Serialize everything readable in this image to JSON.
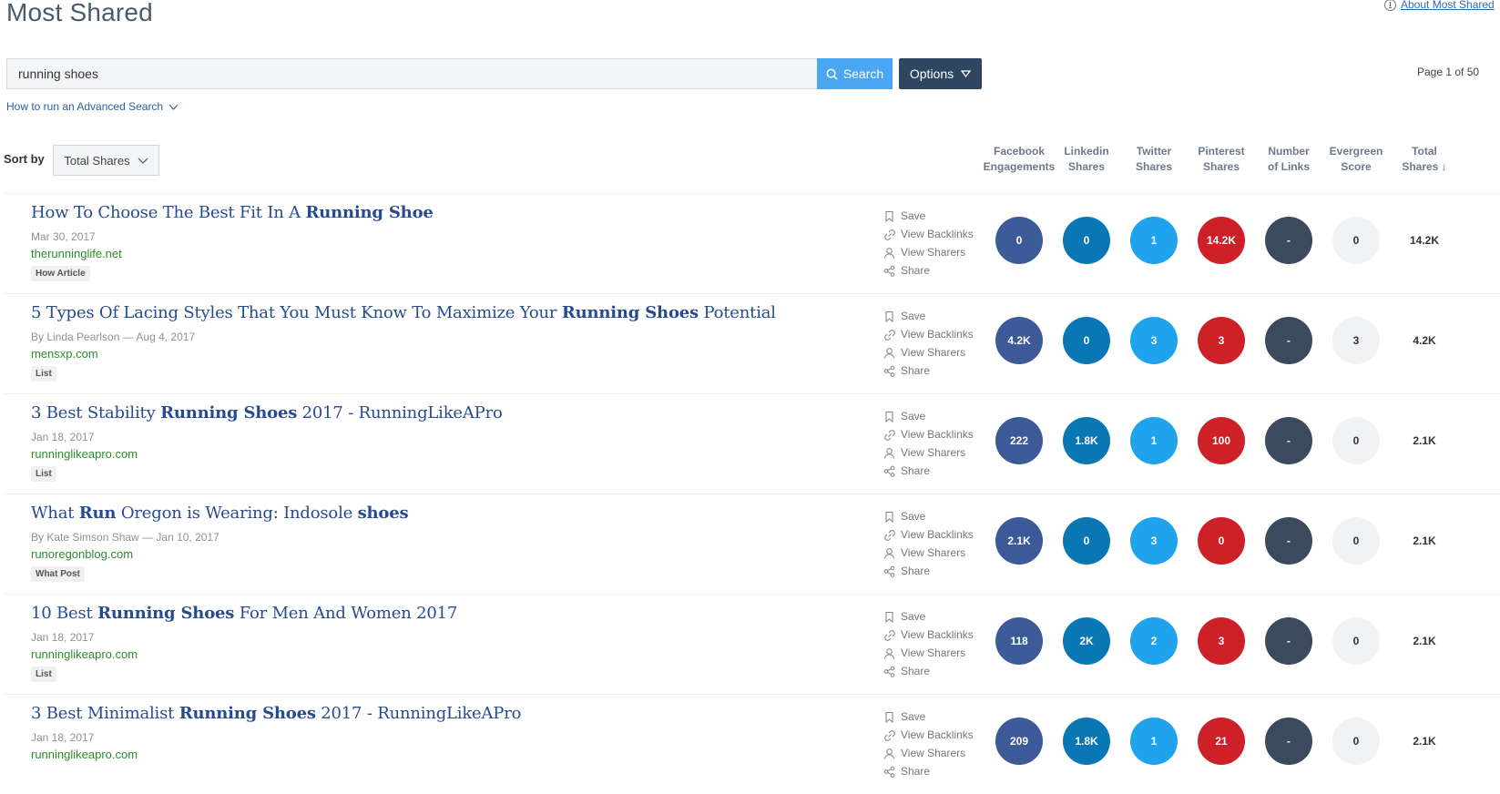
{
  "header": {
    "title": "Most Shared",
    "about_link": "About Most Shared"
  },
  "search": {
    "query": "running shoes",
    "placeholder": "",
    "search_label": "Search",
    "options_label": "Options",
    "page_indicator": "Page 1 of 50",
    "advanced_link": "How to run an Advanced Search"
  },
  "sort": {
    "label": "Sort by",
    "selected": "Total Shares"
  },
  "columns": [
    {
      "line1": "Facebook",
      "line2": "Engagements"
    },
    {
      "line1": "Linkedin",
      "line2": "Shares"
    },
    {
      "line1": "Twitter",
      "line2": "Shares"
    },
    {
      "line1": "Pinterest",
      "line2": "Shares"
    },
    {
      "line1": "Number",
      "line2": "of Links"
    },
    {
      "line1": "Evergreen",
      "line2": "Score"
    },
    {
      "line1": "Total",
      "line2": "Shares ↓"
    }
  ],
  "actions": [
    "Save",
    "View Backlinks",
    "View Sharers",
    "Share"
  ],
  "articles": [
    {
      "title_parts": [
        {
          "t": "How To Choose The Best Fit In A ",
          "b": false
        },
        {
          "t": "Running Shoe",
          "b": true
        }
      ],
      "meta": "Mar 30, 2017",
      "domain": "therunninglife.net",
      "tag": "How Article",
      "facebook": "0",
      "linkedin": "0",
      "twitter": "1",
      "pinterest": "14.2K",
      "links": "-",
      "evergreen": "0",
      "total": "14.2K"
    },
    {
      "title_parts": [
        {
          "t": "5 Types Of Lacing Styles That You Must Know To Maximize Your ",
          "b": false
        },
        {
          "t": "Running Shoes",
          "b": true
        },
        {
          "t": " Potential",
          "b": false
        }
      ],
      "meta": "By Linda Pearlson — Aug 4, 2017",
      "domain": "mensxp.com",
      "tag": "List",
      "facebook": "4.2K",
      "linkedin": "0",
      "twitter": "3",
      "pinterest": "3",
      "links": "-",
      "evergreen": "3",
      "total": "4.2K"
    },
    {
      "title_parts": [
        {
          "t": "3 Best Stability ",
          "b": false
        },
        {
          "t": "Running Shoes",
          "b": true
        },
        {
          "t": " 2017 - RunningLikeAPro",
          "b": false
        }
      ],
      "meta": "Jan 18, 2017",
      "domain": "runninglikeapro.com",
      "tag": "List",
      "facebook": "222",
      "linkedin": "1.8K",
      "twitter": "1",
      "pinterest": "100",
      "links": "-",
      "evergreen": "0",
      "total": "2.1K"
    },
    {
      "title_parts": [
        {
          "t": "What ",
          "b": false
        },
        {
          "t": "Run",
          "b": true
        },
        {
          "t": " Oregon is Wearing: Indosole ",
          "b": false
        },
        {
          "t": "shoes",
          "b": true
        }
      ],
      "meta": "By Kate Simson Shaw — Jan 10, 2017",
      "domain": "runoregonblog.com",
      "tag": "What Post",
      "facebook": "2.1K",
      "linkedin": "0",
      "twitter": "3",
      "pinterest": "0",
      "links": "-",
      "evergreen": "0",
      "total": "2.1K"
    },
    {
      "title_parts": [
        {
          "t": "10 Best ",
          "b": false
        },
        {
          "t": "Running Shoes",
          "b": true
        },
        {
          "t": " For Men And Women 2017",
          "b": false
        }
      ],
      "meta": "Jan 18, 2017",
      "domain": "runninglikeapro.com",
      "tag": "List",
      "facebook": "118",
      "linkedin": "2K",
      "twitter": "2",
      "pinterest": "3",
      "links": "-",
      "evergreen": "0",
      "total": "2.1K"
    },
    {
      "title_parts": [
        {
          "t": "3 Best Minimalist ",
          "b": false
        },
        {
          "t": "Running Shoes",
          "b": true
        },
        {
          "t": " 2017 - RunningLikeAPro",
          "b": false
        }
      ],
      "meta": "Jan 18, 2017",
      "domain": "runninglikeapro.com",
      "tag": "",
      "facebook": "209",
      "linkedin": "1.8K",
      "twitter": "1",
      "pinterest": "21",
      "links": "-",
      "evergreen": "0",
      "total": "2.1K"
    }
  ]
}
